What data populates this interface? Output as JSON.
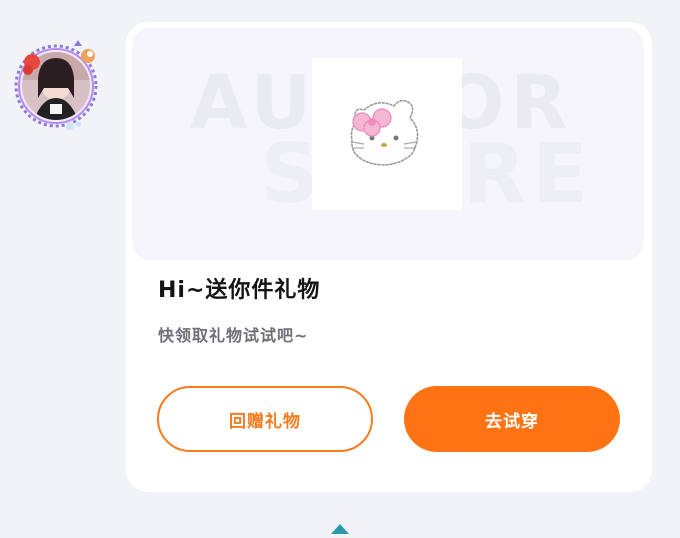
{
  "banner": {
    "watermark_line1": "AUTHOR",
    "watermark_line2": "STORE"
  },
  "dialog": {
    "title": "Hi~送你件礼物",
    "message": "快领取礼物试试吧~"
  },
  "buttons": {
    "return_gift": "回赠礼物",
    "try_on": "去试穿"
  },
  "colors": {
    "accent": "#fe7414",
    "card": "#ffffff",
    "background": "#f2f3f6"
  }
}
